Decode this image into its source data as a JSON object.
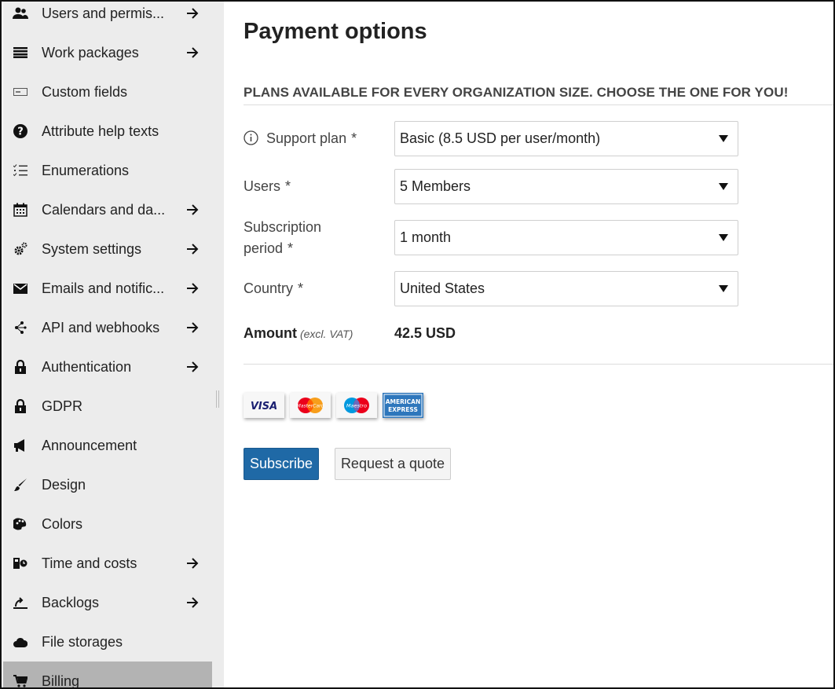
{
  "sidebar": {
    "items": [
      {
        "label": "Users and permis...",
        "icon": "users-icon",
        "arrow": true
      },
      {
        "label": "Work packages",
        "icon": "list-icon",
        "arrow": true
      },
      {
        "label": "Custom fields",
        "icon": "custom-field-icon",
        "arrow": false
      },
      {
        "label": "Attribute help texts",
        "icon": "help-icon",
        "arrow": false
      },
      {
        "label": "Enumerations",
        "icon": "checklist-icon",
        "arrow": false
      },
      {
        "label": "Calendars and da...",
        "icon": "calendar-icon",
        "arrow": true
      },
      {
        "label": "System settings",
        "icon": "settings-icon",
        "arrow": true
      },
      {
        "label": "Emails and notific...",
        "icon": "mail-icon",
        "arrow": true
      },
      {
        "label": "API and webhooks",
        "icon": "api-icon",
        "arrow": true
      },
      {
        "label": "Authentication",
        "icon": "lock-icon",
        "arrow": true
      },
      {
        "label": "GDPR",
        "icon": "lock-icon",
        "arrow": false
      },
      {
        "label": "Announcement",
        "icon": "megaphone-icon",
        "arrow": false
      },
      {
        "label": "Design",
        "icon": "brush-icon",
        "arrow": false
      },
      {
        "label": "Colors",
        "icon": "palette-icon",
        "arrow": false
      },
      {
        "label": "Time and costs",
        "icon": "time-costs-icon",
        "arrow": true
      },
      {
        "label": "Backlogs",
        "icon": "backlogs-icon",
        "arrow": true
      },
      {
        "label": "File storages",
        "icon": "cloud-icon",
        "arrow": false
      },
      {
        "label": "Billing",
        "icon": "cart-icon",
        "arrow": false,
        "active": true
      }
    ]
  },
  "main": {
    "title": "Payment options",
    "plans_heading": "PLANS AVAILABLE FOR EVERY ORGANIZATION SIZE. CHOOSE THE ONE FOR YOU!",
    "fields": {
      "support_plan": {
        "label": "Support plan",
        "required": "*",
        "value": "Basic (8.5 USD per user/month)"
      },
      "users": {
        "label": "Users",
        "required": "*",
        "value": "5 Members"
      },
      "subscription_period": {
        "label_line1": "Subscription",
        "label_line2": "period",
        "required": "*",
        "value": "1 month"
      },
      "country": {
        "label": "Country",
        "required": "*",
        "value": "United States"
      }
    },
    "amount": {
      "label": "Amount",
      "note": "(excl. VAT)",
      "value": "42.5 USD"
    },
    "cards": [
      {
        "name": "VISA",
        "icon": "visa-card-icon"
      },
      {
        "name": "MasterCard",
        "icon": "mastercard-icon"
      },
      {
        "name": "Maestro",
        "icon": "maestro-icon"
      },
      {
        "name": "AMERICAN EXPRESS",
        "icon": "amex-icon"
      }
    ],
    "buttons": {
      "subscribe": "Subscribe",
      "quote": "Request a quote"
    }
  },
  "colors": {
    "primary": "#1f69a6",
    "sidebar_bg": "#ececec",
    "active_bg": "#b3b3b3"
  }
}
